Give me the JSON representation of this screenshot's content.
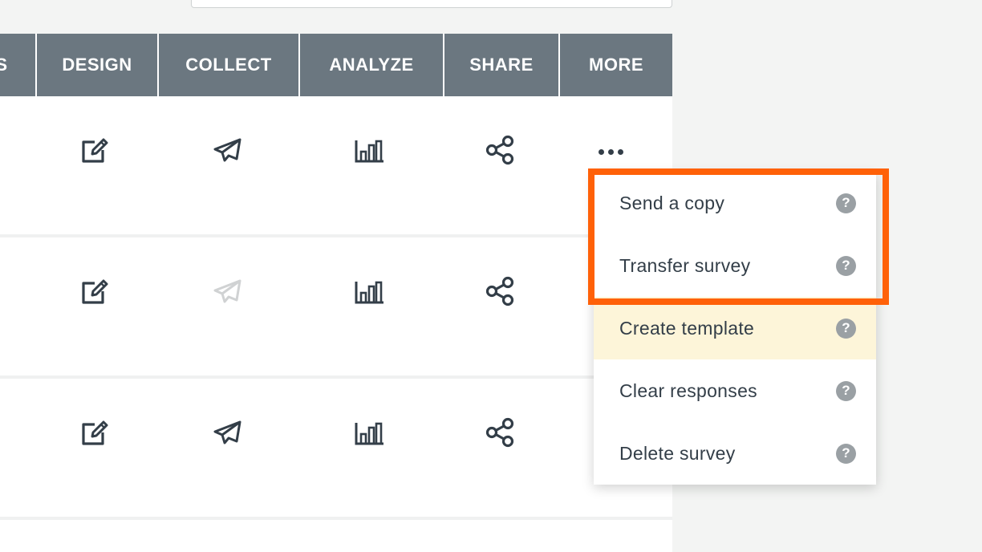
{
  "tabs": [
    {
      "label": "S"
    },
    {
      "label": "DESIGN"
    },
    {
      "label": "COLLECT"
    },
    {
      "label": "ANALYZE"
    },
    {
      "label": "SHARE"
    },
    {
      "label": "MORE"
    }
  ],
  "rows": [
    {
      "icons": [
        "edit-icon",
        "send-icon",
        "analyze-chart-icon",
        "share-icon",
        "more-icon"
      ],
      "collect_enabled": true
    },
    {
      "icons": [
        "edit-icon",
        "send-icon",
        "analyze-chart-icon",
        "share-icon"
      ],
      "collect_enabled": false
    },
    {
      "icons": [
        "edit-icon",
        "send-icon",
        "analyze-chart-icon",
        "share-icon"
      ],
      "collect_enabled": true
    }
  ],
  "more_menu": {
    "items": [
      {
        "label": "Send a copy",
        "help": "?"
      },
      {
        "label": "Transfer survey",
        "help": "?"
      },
      {
        "label": "Create template",
        "help": "?",
        "hovered": true
      },
      {
        "label": "Clear responses",
        "help": "?"
      },
      {
        "label": "Delete survey",
        "help": "?"
      }
    ]
  },
  "colors": {
    "tab_bar": "#6b7780",
    "icon": "#333e48",
    "icon_disabled": "#d0d2d3",
    "highlight_box": "#ff6108",
    "hover_row": "#fdf5d9",
    "help_badge": "#9aa0a4"
  }
}
